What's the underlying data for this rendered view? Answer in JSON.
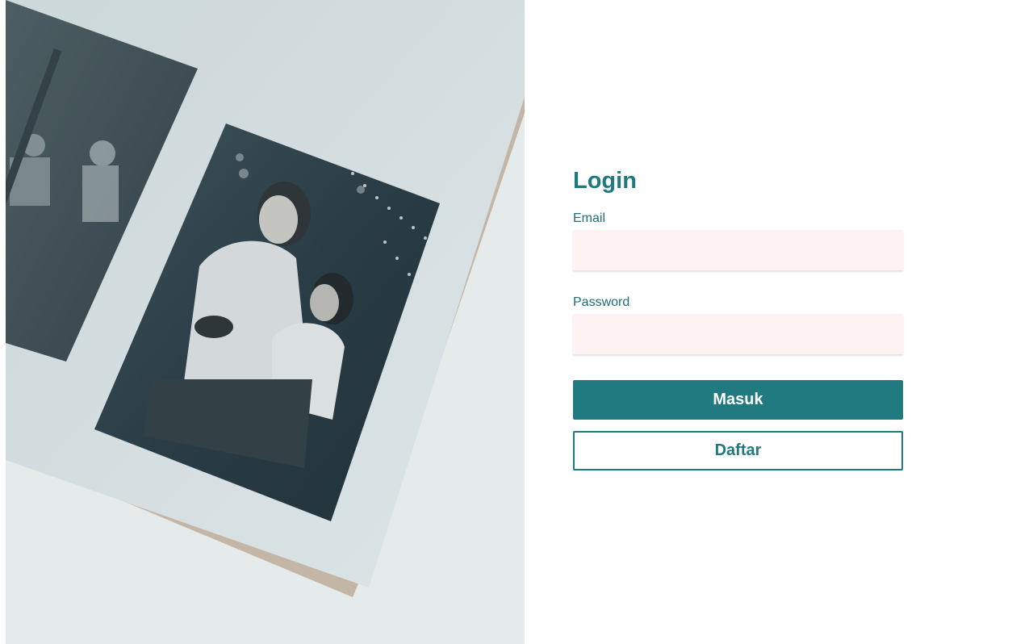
{
  "login": {
    "title": "Login",
    "email_label": "Email",
    "email_value": "",
    "password_label": "Password",
    "password_value": "",
    "submit_label": "Masuk",
    "register_label": "Daftar"
  },
  "colors": {
    "primary": "#217a7f",
    "input_background": "#fef3f2",
    "text_teal": "#1e7a80"
  }
}
